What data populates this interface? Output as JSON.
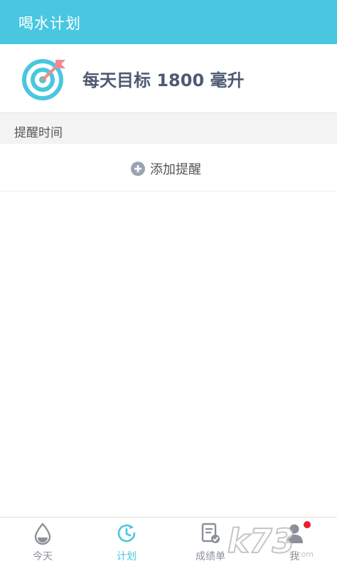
{
  "app": {
    "title": "喝水计划"
  },
  "goal": {
    "text": "每天目标 1800 毫升"
  },
  "reminders": {
    "section_label": "提醒时间",
    "add_label": "添加提醒"
  },
  "nav": {
    "tabs": [
      {
        "label": "今天",
        "icon": "water-drop-icon",
        "active": false
      },
      {
        "label": "计划",
        "icon": "clock-icon",
        "active": true
      },
      {
        "label": "成绩单",
        "icon": "report-icon",
        "active": false
      },
      {
        "label": "我",
        "icon": "person-icon",
        "active": false
      }
    ]
  },
  "colors": {
    "accent": "#49c7e0",
    "goal_text": "#4d5a72",
    "inactive": "#8a8f99",
    "badge": "#e8202f"
  },
  "watermark": {
    "text": "k73"
  }
}
